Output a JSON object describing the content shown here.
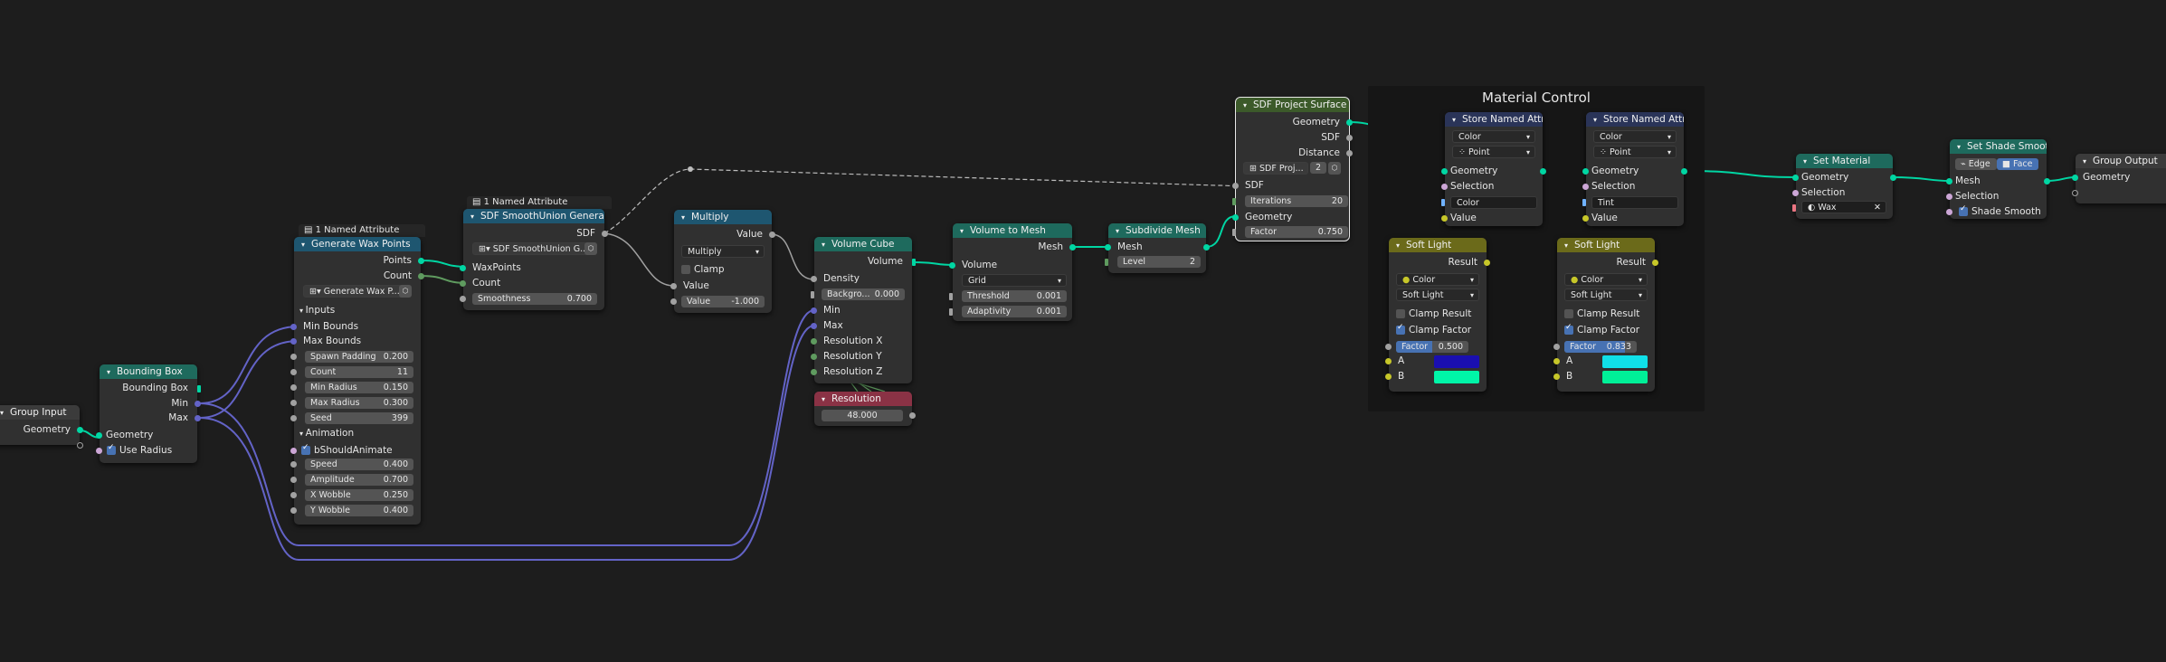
{
  "colors": {
    "background": "#1d1d1d",
    "geometry_socket": "#00d6a3",
    "vector_link": "#6363c7",
    "float_link": "#a1a1a1"
  },
  "frame": {
    "title": "Material Control"
  },
  "group_input": {
    "title": "Group Input",
    "out_geometry": "Geometry"
  },
  "bounding_box": {
    "title": "Bounding Box",
    "out_bbox": "Bounding Box",
    "out_min": "Min",
    "out_max": "Max",
    "in_geometry": "Geometry",
    "use_radius": "Use Radius"
  },
  "wax_points": {
    "attr_label": "1 Named Attribute",
    "title": "Generate Wax Points",
    "out_points": "Points",
    "out_count": "Count",
    "group_name": "Generate Wax P...",
    "inputs_panel": "Inputs",
    "min_bounds": "Min Bounds",
    "max_bounds": "Max Bounds",
    "fields": [
      {
        "label": "Spawn Padding",
        "value": "0.200"
      },
      {
        "label": "Count",
        "value": "11"
      },
      {
        "label": "Min Radius",
        "value": "0.150"
      },
      {
        "label": "Max Radius",
        "value": "0.300"
      },
      {
        "label": "Seed",
        "value": "399"
      }
    ],
    "anim_panel": "Animation",
    "should_animate": "bShouldAnimate",
    "anim_fields": [
      {
        "label": "Speed",
        "value": "0.400"
      },
      {
        "label": "Amplitude",
        "value": "0.700"
      },
      {
        "label": "X Wobble",
        "value": "0.250"
      },
      {
        "label": "Y Wobble",
        "value": "0.400"
      }
    ]
  },
  "smooth_union": {
    "attr_label": "1 Named Attribute",
    "title": "SDF SmoothUnion Generalized",
    "out_sdf": "SDF",
    "group_name": "SDF SmoothUnion G...",
    "in_waxpoints": "WaxPoints",
    "in_count": "Count",
    "smoothness_label": "Smoothness",
    "smoothness_value": "0.700"
  },
  "multiply": {
    "title": "Multiply",
    "out_value": "Value",
    "operation": "Multiply",
    "clamp": "Clamp",
    "in_value": "Value",
    "value_label": "Value",
    "value_value": "-1.000"
  },
  "volume_cube": {
    "title": "Volume Cube",
    "out_volume": "Volume",
    "in_density": "Density",
    "background_label": "Backgro...",
    "background_value": "0.000",
    "in_min": "Min",
    "in_max": "Max",
    "res_x": "Resolution X",
    "res_y": "Resolution Y",
    "res_z": "Resolution Z"
  },
  "resolution": {
    "title": "Resolution",
    "value": "48.000"
  },
  "volume_to_mesh": {
    "title": "Volume to Mesh",
    "out_mesh": "Mesh",
    "in_volume": "Volume",
    "mode": "Grid",
    "threshold_label": "Threshold",
    "threshold_value": "0.001",
    "adaptivity_label": "Adaptivity",
    "adaptivity_value": "0.001"
  },
  "subdivide": {
    "title": "Subdivide Mesh",
    "in_mesh": "Mesh",
    "level_label": "Level",
    "level_value": "2"
  },
  "project_surface": {
    "title": "SDF Project Surface",
    "out_geometry": "Geometry",
    "out_sdf": "SDF",
    "out_distance": "Distance",
    "group_name": "SDF Proj...",
    "users": "2",
    "in_sdf": "SDF",
    "iterations_label": "Iterations",
    "iterations_value": "20",
    "in_geometry": "Geometry",
    "factor_label": "Factor",
    "factor_value": "0.750"
  },
  "store_attr_1": {
    "title": "Store Named Attri...",
    "type": "Color",
    "domain": "Point",
    "in_geometry": "Geometry",
    "in_selection": "Selection",
    "name_value": "Color",
    "in_value": "Value"
  },
  "store_attr_2": {
    "title": "Store Named Attri...",
    "type": "Color",
    "domain": "Point",
    "in_geometry": "Geometry",
    "in_selection": "Selection",
    "name_value": "Tint",
    "in_value": "Value"
  },
  "soft_light_1": {
    "title": "Soft Light",
    "out_result": "Result",
    "data_type": "Color",
    "blend": "Soft Light",
    "clamp_result": "Clamp Result",
    "clamp_factor": "Clamp Factor",
    "factor_label": "Factor",
    "factor_value": "0.500",
    "a_label": "A",
    "b_label": "B",
    "a_color": "#1a0fb0",
    "b_color": "#00f5a8",
    "factor_fill": 0.5
  },
  "soft_light_2": {
    "title": "Soft Light",
    "out_result": "Result",
    "data_type": "Color",
    "blend": "Soft Light",
    "clamp_result": "Clamp Result",
    "clamp_factor": "Clamp Factor",
    "factor_label": "Factor",
    "factor_value": "0.833",
    "a_label": "A",
    "b_label": "B",
    "a_color": "#10e0e8",
    "b_color": "#00f098",
    "factor_fill": 0.833
  },
  "set_material": {
    "title": "Set Material",
    "out_geometry": "Geometry",
    "in_geometry": "Geometry",
    "in_selection": "Selection",
    "material": "Wax"
  },
  "shade_smooth": {
    "title": "Set Shade Smooth",
    "domain_edge": "Edge",
    "domain_face": "Face",
    "in_mesh": "Mesh",
    "in_selection": "Selection",
    "shade_smooth": "Shade Smooth"
  },
  "group_output": {
    "title": "Group Output",
    "in_geometry": "Geometry"
  }
}
